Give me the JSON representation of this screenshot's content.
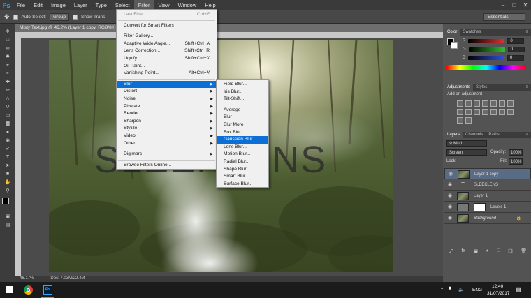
{
  "menubar": {
    "logo": "Ps",
    "items": [
      "File",
      "Edit",
      "Image",
      "Layer",
      "Type",
      "Select",
      "Filter",
      "View",
      "Window",
      "Help"
    ],
    "active": "Filter"
  },
  "options": {
    "auto_select": "Auto-Select:",
    "group": "Group",
    "show_transform": "Show Trans",
    "workspace": "Essentials"
  },
  "document": {
    "tab_title": "Misty Text.jpg @ 46.2% (Layer 1 copy, RGB/8#)",
    "zoom": "46.17%",
    "doc_size": "Doc: 7.03M/22.4M",
    "canvas_text": "SLEEKLENS"
  },
  "filter_menu": {
    "items": [
      {
        "label": "Last Filter",
        "shortcut": "Ctrl+F",
        "disabled": true
      },
      {
        "sep": true
      },
      {
        "label": "Convert for Smart Filters"
      },
      {
        "sep": true
      },
      {
        "label": "Filter Gallery..."
      },
      {
        "label": "Adaptive Wide Angle...",
        "shortcut": "Shift+Ctrl+A"
      },
      {
        "label": "Lens Correction...",
        "shortcut": "Shift+Ctrl+R"
      },
      {
        "label": "Liquify...",
        "shortcut": "Shift+Ctrl+X"
      },
      {
        "label": "Oil Paint..."
      },
      {
        "label": "Vanishing Point...",
        "shortcut": "Alt+Ctrl+V"
      },
      {
        "sep": true
      },
      {
        "label": "Blur",
        "submenu": true,
        "highlight": true
      },
      {
        "label": "Distort",
        "submenu": true
      },
      {
        "label": "Noise",
        "submenu": true
      },
      {
        "label": "Pixelate",
        "submenu": true
      },
      {
        "label": "Render",
        "submenu": true
      },
      {
        "label": "Sharpen",
        "submenu": true
      },
      {
        "label": "Stylize",
        "submenu": true
      },
      {
        "label": "Video",
        "submenu": true
      },
      {
        "label": "Other",
        "submenu": true
      },
      {
        "sep": true
      },
      {
        "label": "Digimarc",
        "submenu": true
      },
      {
        "sep": true
      },
      {
        "label": "Browse Filters Online..."
      }
    ]
  },
  "blur_menu": {
    "items": [
      {
        "label": "Field Blur..."
      },
      {
        "label": "Iris Blur..."
      },
      {
        "label": "Tilt-Shift..."
      },
      {
        "sep": true
      },
      {
        "label": "Average"
      },
      {
        "label": "Blur"
      },
      {
        "label": "Blur More"
      },
      {
        "label": "Box Blur..."
      },
      {
        "label": "Gaussian Blur...",
        "highlight": true
      },
      {
        "label": "Lens Blur..."
      },
      {
        "label": "Motion Blur..."
      },
      {
        "label": "Radial Blur..."
      },
      {
        "label": "Shape Blur..."
      },
      {
        "label": "Smart Blur..."
      },
      {
        "label": "Surface Blur..."
      }
    ]
  },
  "color_panel": {
    "tabs": [
      "Color",
      "Swatches"
    ],
    "channels": [
      {
        "label": "R",
        "value": "0",
        "color": "#e03030"
      },
      {
        "label": "G",
        "value": "0",
        "color": "#30c030"
      },
      {
        "label": "B",
        "value": "0",
        "color": "#3050e0"
      }
    ]
  },
  "adjustments_panel": {
    "tabs": [
      "Adjustments",
      "Styles"
    ],
    "hint": "Add an adjustment"
  },
  "layers_panel": {
    "tabs": [
      "Layers",
      "Channels",
      "Paths"
    ],
    "kind": "Kind",
    "blend_mode": "Screen",
    "opacity_label": "Opacity:",
    "opacity": "100%",
    "lock_label": "Lock:",
    "fill_label": "Fill:",
    "fill": "100%",
    "layers": [
      {
        "name": "Layer 1 copy",
        "selected": true,
        "type": "image"
      },
      {
        "name": "SLEEKLENS",
        "type": "text"
      },
      {
        "name": "Layer 1",
        "type": "image"
      },
      {
        "name": "Levels 1",
        "type": "adjust"
      },
      {
        "name": "Background",
        "type": "image",
        "italic": true
      }
    ]
  },
  "taskbar": {
    "lang": "ENG",
    "time": "12:40",
    "date": "31/07/2017"
  }
}
